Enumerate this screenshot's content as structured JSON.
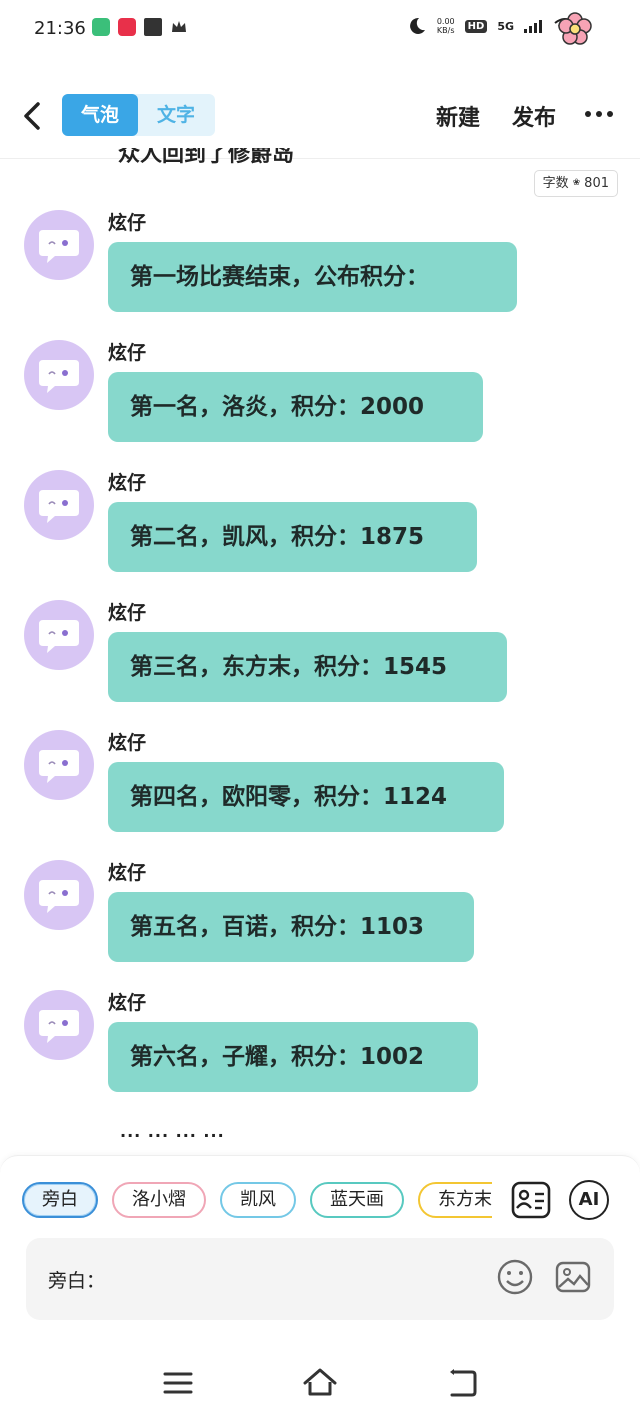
{
  "status_bar": {
    "time": "21:36",
    "speed_value": "0.00",
    "speed_unit": "KB/s",
    "hd_label": "HD",
    "network_label": "5G"
  },
  "header": {
    "tabs": [
      {
        "label": "气泡",
        "active": true
      },
      {
        "label": "文字",
        "active": false
      }
    ],
    "new_label": "新建",
    "publish_label": "发布",
    "more_label": "···"
  },
  "content": {
    "partial_title": "众人回到了修爵岛",
    "word_count_label": "字数",
    "word_count_value": "801",
    "messages": [
      {
        "speaker": "炫仔",
        "text": "第一场比赛结束，公布积分："
      },
      {
        "speaker": "炫仔",
        "text": "第一名，洛炎，积分：2000"
      },
      {
        "speaker": "炫仔",
        "text": "第二名，凯风，积分：1875"
      },
      {
        "speaker": "炫仔",
        "text": "第三名，东方末，积分：1545"
      },
      {
        "speaker": "炫仔",
        "text": "第四名，欧阳零，积分：1124"
      },
      {
        "speaker": "炫仔",
        "text": "第五名，百诺，积分：1103"
      },
      {
        "speaker": "炫仔",
        "text": "第六名，子耀，积分：1002"
      }
    ],
    "ellipsis": "··· ··· ··· ···"
  },
  "composer": {
    "roles": [
      {
        "label": "旁白",
        "style": "sel"
      },
      {
        "label": "洛小熠",
        "style": "pink"
      },
      {
        "label": "凯风",
        "style": "blue"
      },
      {
        "label": "蓝天画",
        "style": "teal"
      },
      {
        "label": "东方末",
        "style": "yellow"
      }
    ],
    "ai_label": "AI",
    "input_value": "旁白："
  },
  "colors": {
    "bubble": "#87d8cc",
    "avatar": "#d8c6f4",
    "accent": "#3aa6e6"
  },
  "icons": [
    "back-arrow-icon",
    "more-icon",
    "avatar-chat-icon",
    "character-card-icon",
    "emoji-icon",
    "image-icon",
    "menu-icon",
    "home-icon",
    "back-icon"
  ]
}
